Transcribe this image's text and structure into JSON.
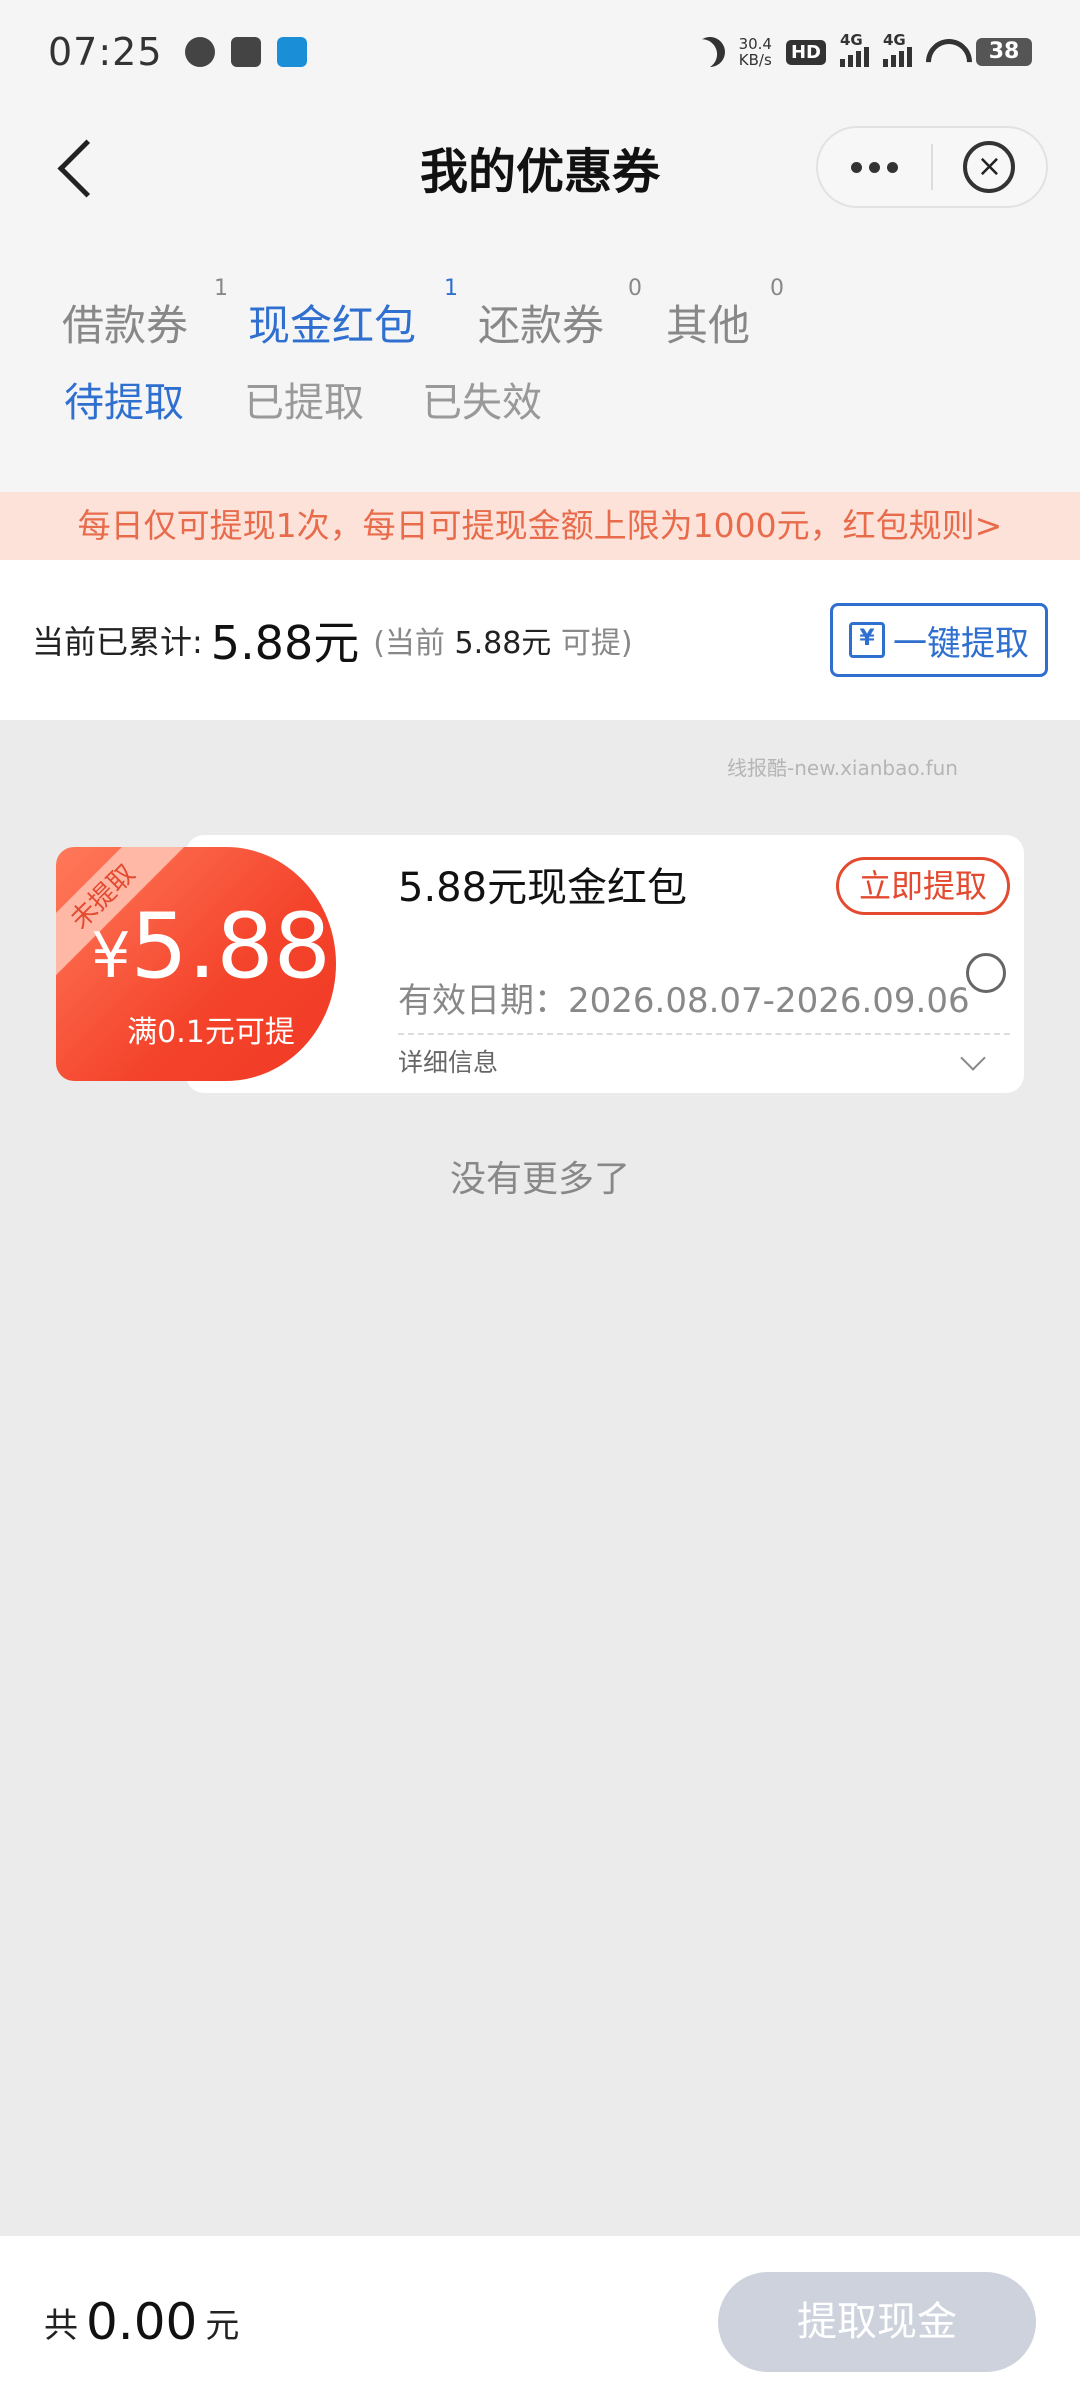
{
  "status_bar": {
    "time": "07:25",
    "net_speed_value": "30.4",
    "net_speed_unit": "KB/s",
    "hd_label": "HD",
    "signal_label_1": "4G",
    "signal_label_2": "4G",
    "battery": "38"
  },
  "header": {
    "title": "我的优惠券"
  },
  "tabs": [
    {
      "label": "借款券",
      "count": "1"
    },
    {
      "label": "现金红包",
      "count": "1"
    },
    {
      "label": "还款券",
      "count": "0"
    },
    {
      "label": "其他",
      "count": "0"
    }
  ],
  "subtabs": [
    {
      "label": "待提取"
    },
    {
      "label": "已提取"
    },
    {
      "label": "已失效"
    }
  ],
  "notice": "每日仅可提现1次，每日可提现金额上限为1000元，红包规则>",
  "summary": {
    "label": "当前已累计:",
    "amount": "5.88元",
    "note_prefix": "(当前",
    "note_amount": "5.88元",
    "note_suffix": "可提)",
    "claim_all_label": "一键提取",
    "claim_all_icon_glyph": "¥"
  },
  "watermark": "线报酷-new.xianbao.fun",
  "coupon": {
    "ribbon": "未提取",
    "currency": "¥",
    "value": "5.88",
    "condition": "满0.1元可提",
    "title": "5.88元现金红包",
    "redeem_label": "立即提取",
    "validity": "有效日期：2026.08.07-2026.09.06",
    "detail_label": "详细信息"
  },
  "no_more": "没有更多了",
  "bottom": {
    "total_label": "共",
    "total_amount": "0.00",
    "total_unit": "元",
    "withdraw_label": "提取现金"
  }
}
